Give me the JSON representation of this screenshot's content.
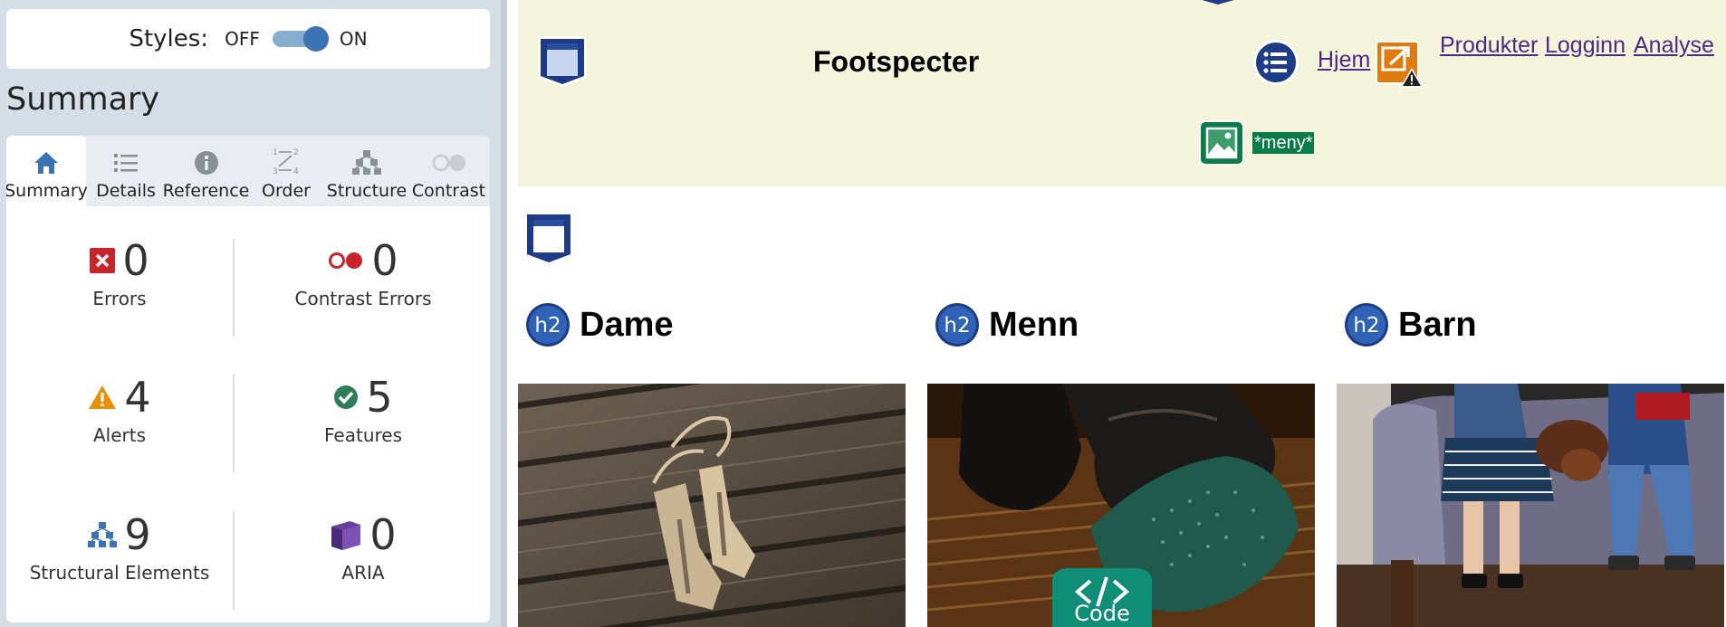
{
  "panel": {
    "styles_label": "Styles:",
    "toggle_off": "OFF",
    "toggle_on": "ON",
    "heading": "Summary",
    "tabs": [
      {
        "label": "Summary",
        "icon": "home-icon"
      },
      {
        "label": "Details",
        "icon": "list-icon"
      },
      {
        "label": "Reference",
        "icon": "info-icon"
      },
      {
        "label": "Order",
        "icon": "order-icon"
      },
      {
        "label": "Structure",
        "icon": "structure-icon"
      },
      {
        "label": "Contrast",
        "icon": "contrast-icon"
      }
    ],
    "stats": {
      "errors": {
        "count": "0",
        "label": "Errors"
      },
      "contrast_errors": {
        "count": "0",
        "label": "Contrast Errors"
      },
      "alerts": {
        "count": "4",
        "label": "Alerts"
      },
      "features": {
        "count": "5",
        "label": "Features"
      },
      "structural": {
        "count": "9",
        "label": "Structural Elements"
      },
      "aria": {
        "count": "0",
        "label": "ARIA"
      }
    },
    "colors": {
      "error": "#c7252b",
      "alert": "#e8900c",
      "feature": "#2f7d5b",
      "structural": "#3b73b5",
      "aria": "#6b3fa0"
    }
  },
  "page": {
    "title": "Footspecter",
    "nav": [
      "Hjem",
      "Produkter",
      "Logginn",
      "Analyse"
    ],
    "menu_alt": "*meny*",
    "sections": [
      "Dame",
      "Menn",
      "Barn"
    ],
    "h2_badge": "h2",
    "code_badge": "Code",
    "header_bg": "#f4f4dd"
  }
}
